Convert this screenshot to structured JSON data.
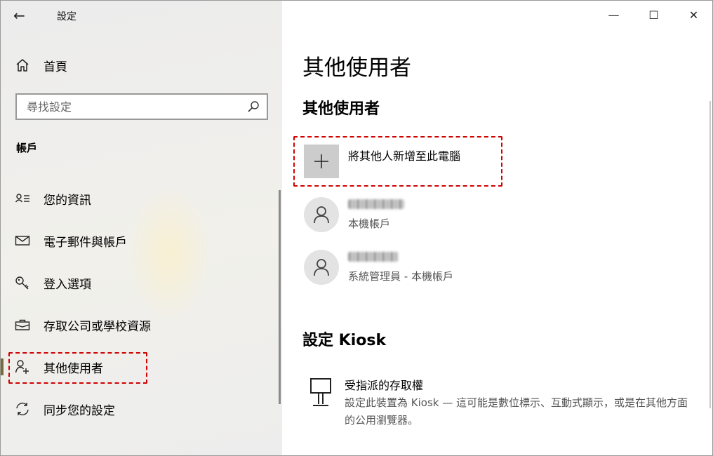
{
  "window": {
    "title": "設定",
    "controls": {
      "minimize": "—",
      "maximize": "☐",
      "close": "✕"
    }
  },
  "sidebar": {
    "home_label": "首頁",
    "search_placeholder": "尋找設定",
    "section_label": "帳戶",
    "items": [
      {
        "label": "您的資訊",
        "icon": "person-info-icon"
      },
      {
        "label": "電子郵件與帳戶",
        "icon": "mail-icon"
      },
      {
        "label": "登入選項",
        "icon": "key-icon"
      },
      {
        "label": "存取公司或學校資源",
        "icon": "briefcase-icon"
      },
      {
        "label": "其他使用者",
        "icon": "add-person-icon",
        "active": true
      },
      {
        "label": "同步您的設定",
        "icon": "sync-icon"
      }
    ]
  },
  "main": {
    "page_title": "其他使用者",
    "other_users_heading": "其他使用者",
    "add_user_label": "將其他人新增至此電腦",
    "users": [
      {
        "account_type": "本機帳戶"
      },
      {
        "account_type": "系統管理員 - 本機帳戶"
      }
    ],
    "kiosk_heading": "設定 Kiosk",
    "kiosk_item_title": "受指派的存取權",
    "kiosk_item_desc": "設定此裝置為 Kiosk — 這可能是數位標示、互動式顯示，或是在其他方面的公用瀏覽器。"
  },
  "colors": {
    "highlight_dash": "#d00000",
    "active_indicator": "#7a6a3a",
    "tile_gray": "#cccccc"
  }
}
